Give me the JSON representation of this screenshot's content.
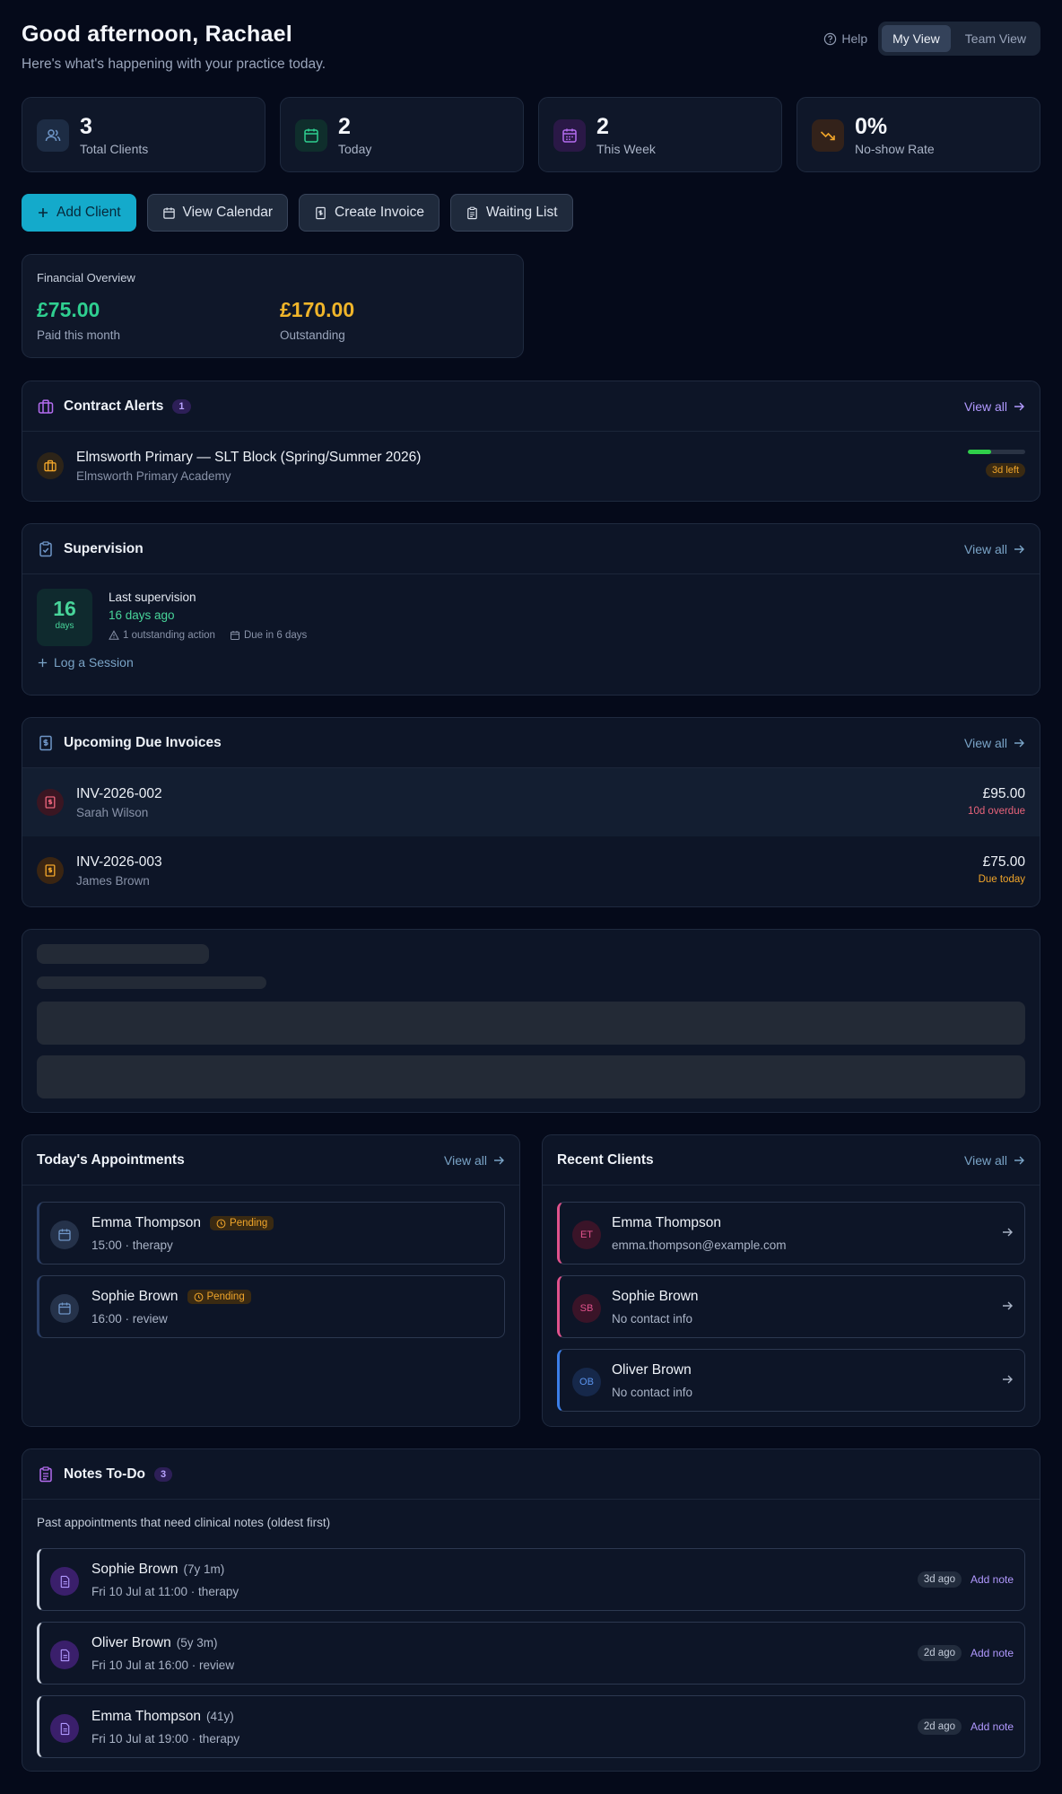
{
  "header": {
    "greeting": "Good afternoon, Rachael",
    "subtitle": "Here's what's happening with your practice today.",
    "help_label": "Help",
    "view_toggle": {
      "my_view": "My View",
      "team_view": "Team View",
      "selected": "My View"
    }
  },
  "stats": [
    {
      "value": "3",
      "label": "Total Clients",
      "icon": "users-icon",
      "color": "#5f86b8"
    },
    {
      "value": "2",
      "label": "Today",
      "icon": "calendar-icon",
      "color": "#2fcf90"
    },
    {
      "value": "2",
      "label": "This Week",
      "icon": "calendar-week-icon",
      "color": "#b46cf0"
    },
    {
      "value": "0%",
      "label": "No-show Rate",
      "icon": "trending-down-icon",
      "color": "#f0a52a"
    }
  ],
  "actions": {
    "add_client": "Add Client",
    "view_calendar": "View Calendar",
    "create_invoice": "Create Invoice",
    "waiting_list": "Waiting List"
  },
  "financial": {
    "title": "Financial Overview",
    "paid_value": "£75.00",
    "paid_label": "Paid this month",
    "outstanding_value": "£170.00",
    "outstanding_label": "Outstanding"
  },
  "contract_alerts": {
    "title": "Contract Alerts",
    "count": "1",
    "view_all": "View all",
    "items": [
      {
        "title": "Elmsworth Primary — SLT Block (Spring/Summer 2026)",
        "subtitle": "Elmsworth Primary Academy",
        "remaining": "3d left",
        "progress": 0.4
      }
    ]
  },
  "supervision": {
    "title": "Supervision",
    "view_all": "View all",
    "days": "16",
    "days_unit": "days",
    "last_label": "Last supervision",
    "ago": "16 days ago",
    "outstanding": "1 outstanding action",
    "due": "Due in 6 days",
    "log_label": "Log a Session"
  },
  "invoices": {
    "title": "Upcoming Due Invoices",
    "view_all": "View all",
    "items": [
      {
        "number": "INV-2026-002",
        "client": "Sarah Wilson",
        "amount": "£95.00",
        "status": "10d overdue",
        "status_color": "#e8637a"
      },
      {
        "number": "INV-2026-003",
        "client": "James Brown",
        "amount": "£75.00",
        "status": "Due today",
        "status_color": "#f0a52a"
      }
    ]
  },
  "appointments": {
    "title": "Today's Appointments",
    "view_all": "View all",
    "items": [
      {
        "name": "Emma Thompson",
        "status": "Pending",
        "time": "15:00 · therapy"
      },
      {
        "name": "Sophie Brown",
        "status": "Pending",
        "time": "16:00 · review"
      }
    ]
  },
  "recent_clients": {
    "title": "Recent Clients",
    "view_all": "View all",
    "items": [
      {
        "initials": "ET",
        "name": "Emma Thompson",
        "contact": "emma.thompson@example.com",
        "accent": "#e0528c"
      },
      {
        "initials": "SB",
        "name": "Sophie Brown",
        "contact": "No contact info",
        "accent": "#e0528c"
      },
      {
        "initials": "OB",
        "name": "Oliver Brown",
        "contact": "No contact info",
        "accent": "#3b7ee8"
      }
    ]
  },
  "notes_todo": {
    "title": "Notes To-Do",
    "count": "3",
    "description": "Past appointments that need clinical notes (oldest first)",
    "add_label": "Add note",
    "items": [
      {
        "name": "Sophie Brown",
        "age": "(7y 1m)",
        "when": "Fri 10 Jul at 11:00 · therapy",
        "ago": "3d ago"
      },
      {
        "name": "Oliver Brown",
        "age": "(5y 3m)",
        "when": "Fri 10 Jul at 16:00 · review",
        "ago": "2d ago"
      },
      {
        "name": "Emma Thompson",
        "age": "(41y)",
        "when": "Fri 10 Jul at 19:00 · therapy",
        "ago": "2d ago"
      }
    ]
  }
}
